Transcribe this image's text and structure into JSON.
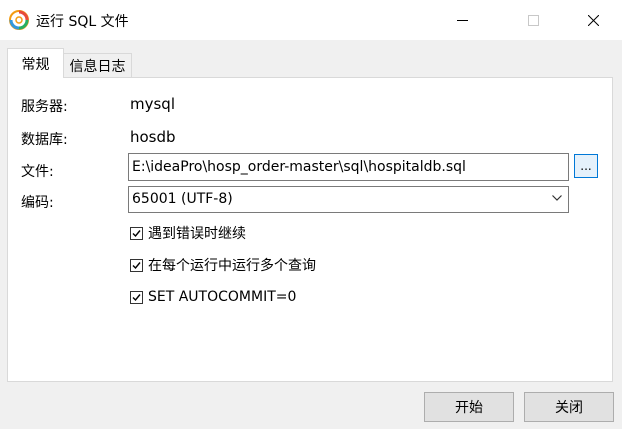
{
  "window": {
    "title": "运行 SQL 文件"
  },
  "tabs": [
    {
      "label": "常规",
      "active": true
    },
    {
      "label": "信息日志",
      "active": false
    }
  ],
  "general": {
    "server_label": "服务器:",
    "server_value": "mysql",
    "database_label": "数据库:",
    "database_value": "hosdb",
    "file_label": "文件:",
    "file_value": "E:\\ideaPro\\hosp_order-master\\sql\\hospitaldb.sql",
    "browse_label": "...",
    "encoding_label": "编码:",
    "encoding_value": "65001 (UTF-8)",
    "options": [
      {
        "label": "遇到错误时继续",
        "checked": true
      },
      {
        "label": "在每个运行中运行多个查询",
        "checked": true
      },
      {
        "label": "SET AUTOCOMMIT=0",
        "checked": true
      }
    ]
  },
  "buttons": {
    "start": "开始",
    "close": "关闭"
  },
  "colors": {
    "accent": "#0078d7",
    "window_bg": "#f0f0f0"
  }
}
